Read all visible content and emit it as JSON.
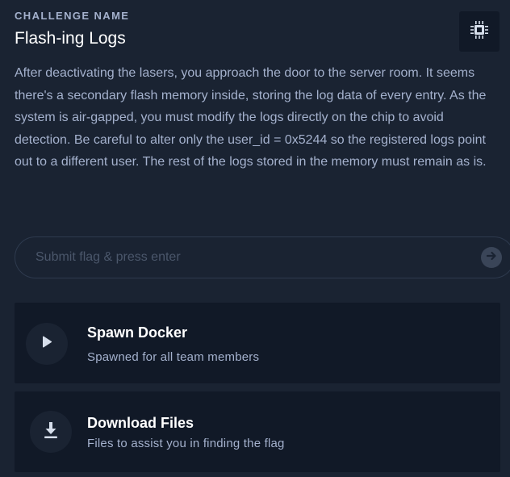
{
  "header": {
    "section_label": "CHALLENGE NAME",
    "title": "Flash-ing Logs",
    "category_icon": "chip-icon"
  },
  "description": "After deactivating the lasers, you approach the door to the server room. It seems there's a secondary flash memory inside, storing the log data of every entry. As the system is air-gapped, you must modify the logs directly on the chip to avoid detection. Be careful to alter only the user_id = 0x5244 so the registered logs point out to a different user. The rest of the logs stored in the memory must remain as is.",
  "flag": {
    "placeholder": "Submit flag & press enter",
    "value": "",
    "submit_icon": "arrow-right-icon"
  },
  "actions": [
    {
      "title": "Spawn Docker",
      "subtitle": "Spawned for all team members",
      "icon": "play-icon"
    },
    {
      "title": "Download Files",
      "subtitle": "Files to assist you in finding the flag",
      "icon": "download-icon"
    }
  ],
  "colors": {
    "background": "#1a2332",
    "card": "#111927",
    "text_muted": "#a4b1cd",
    "text_primary": "#ffffff"
  }
}
